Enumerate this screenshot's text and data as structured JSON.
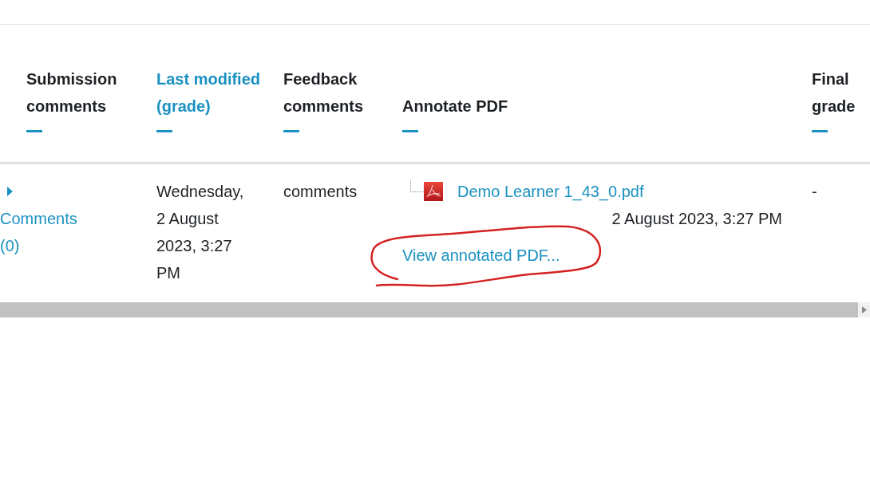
{
  "table": {
    "columns": [
      {
        "label": "Submission comments",
        "selected": false
      },
      {
        "label": "Last modified (grade)",
        "selected": true
      },
      {
        "label": "Feedback comments",
        "selected": false
      },
      {
        "label": "Annotate PDF",
        "selected": false
      },
      {
        "label": "Final grade",
        "selected": false
      }
    ],
    "rows": [
      {
        "submission_comments": {
          "link": "Comments (0)",
          "expanded": false
        },
        "last_modified": "Wednesday, 2 August 2023, 3:27 PM",
        "feedback_comments": "comments",
        "annotate_pdf": {
          "file": "Demo Learner 1_43_0.pdf",
          "date": "2 August 2023, 3:27 PM",
          "view_link": "View annotated PDF..."
        },
        "final_grade": "-"
      }
    ]
  }
}
